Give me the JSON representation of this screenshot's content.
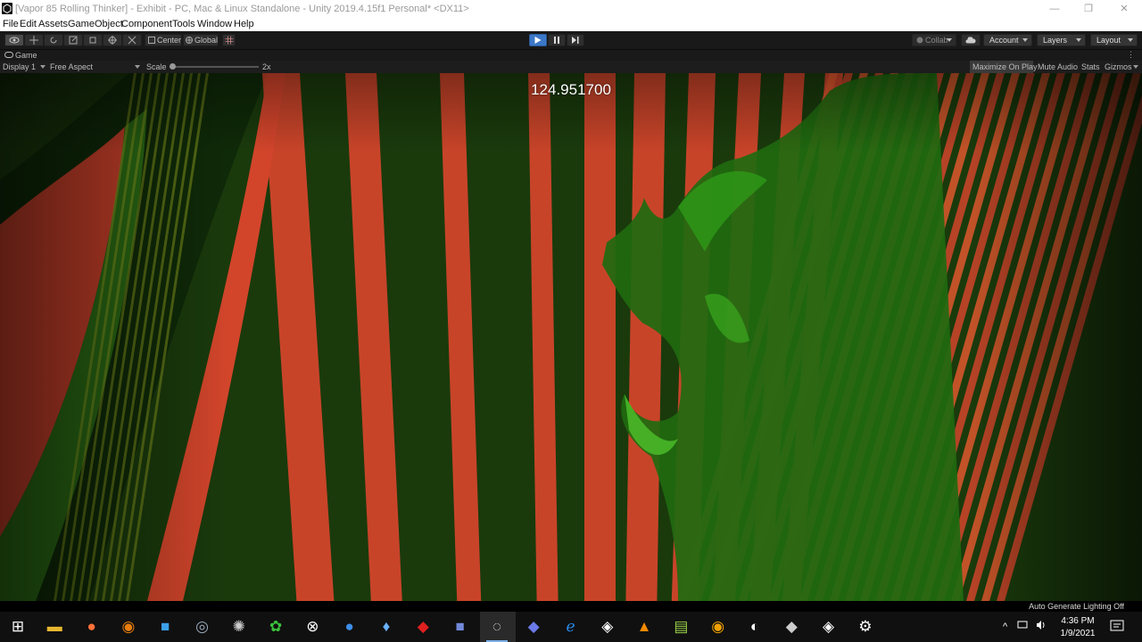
{
  "window": {
    "title": "[Vapor 85 Rolling Thinker] - Exhibit - PC, Mac & Linux Standalone - Unity 2019.4.15f1 Personal* <DX11>",
    "minimize": "—",
    "maximize": "❐",
    "close": "✕"
  },
  "menu": [
    "File",
    "Edit",
    "Assets",
    "GameObject",
    "Component",
    "Tools",
    "Window",
    "Help"
  ],
  "toolbar": {
    "pivot_label": "Center",
    "space_label": "Global",
    "collab_label": "Collab",
    "account_label": "Account",
    "layers_label": "Layers",
    "layout_label": "Layout",
    "playing": true
  },
  "game_tab": {
    "name": "Game"
  },
  "game_bar": {
    "display": "Display 1",
    "aspect": "Free Aspect",
    "scale_label": "Scale",
    "scale_value": "2x",
    "maximize_on_play": "Maximize On Play",
    "mute_audio": "Mute Audio",
    "stats": "Stats",
    "gizmos": "Gizmos"
  },
  "viewport": {
    "timer_text": "124.951700",
    "status_text": "Auto Generate Lighting Off"
  },
  "taskbar": {
    "apps": [
      "start-icon",
      "file-explorer-icon",
      "firefox-icon",
      "blender-icon",
      "app-window-icon",
      "steam-icon",
      "app-swirl-icon",
      "app-green-icon",
      "xbox-icon",
      "app-blue-circle-icon",
      "droplet-icon",
      "app-red-icon",
      "discord-icon",
      "obs-icon",
      "app-diamond-icon",
      "app-e-icon",
      "unity-hub-icon",
      "vlc-icon",
      "notepad-icon",
      "app-ring-icon",
      "app-orange-icon",
      "unity-icon",
      "unity-editor-icon",
      "settings-icon"
    ],
    "time": "4:36 PM",
    "date": "1/9/2021",
    "tray_chevron": "^"
  },
  "colors": {
    "editor_dark": "#191919",
    "play_active": "#3c78c8",
    "scene_orange": "#d2452b",
    "scene_green": "#1f7a12"
  }
}
